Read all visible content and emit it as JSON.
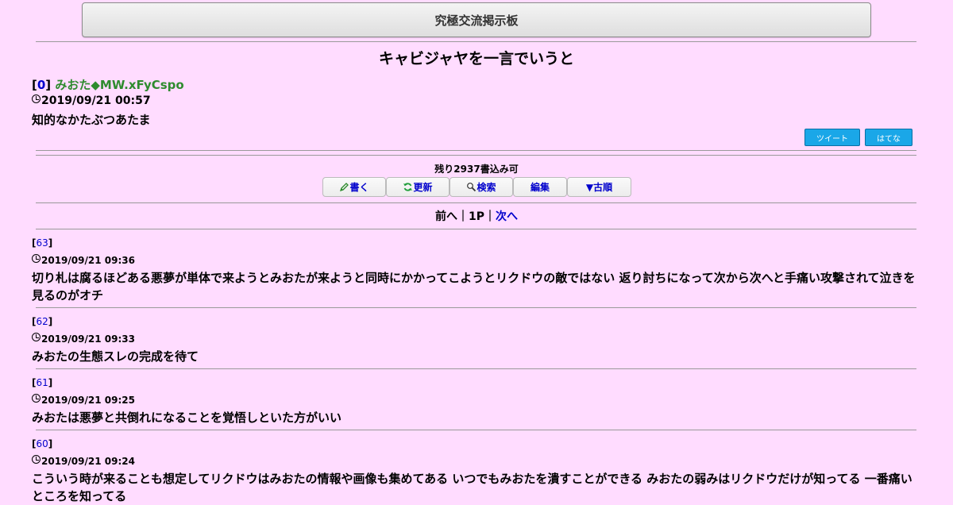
{
  "board": {
    "title": "究極交流掲示板"
  },
  "thread": {
    "title": "キャビジャヤを一言でいうと"
  },
  "op": {
    "number": "0",
    "name": "みおた◆MW.xFyCspo",
    "date": "2019/09/21 00:57",
    "body": "知的なかたぶつあたま"
  },
  "share": {
    "tweet_label": "ツイート",
    "hatena_label": "はてな"
  },
  "remaining": "残り2937書込み可",
  "toolbar": {
    "write_label": "書く",
    "refresh_label": "更新",
    "search_label": "検索",
    "edit_label": "編集",
    "order_label": "▼古順"
  },
  "pager": {
    "prev": "前へ",
    "sep": "｜",
    "current": "1P",
    "next": "次へ"
  },
  "posts": [
    {
      "number": "63",
      "date": "2019/09/21 09:36",
      "body": "切り札は腐るほどある悪夢が単体で来ようとみおたが来ようと同時にかかってこようとリクドウの敵ではない 返り討ちになって次から次へと手痛い攻撃されて泣きを見るのがオチ"
    },
    {
      "number": "62",
      "date": "2019/09/21 09:33",
      "body": "みおたの生態スレの完成を待て"
    },
    {
      "number": "61",
      "date": "2019/09/21 09:25",
      "body": "みおたは悪夢と共倒れになることを覚悟しといた方がいい"
    },
    {
      "number": "60",
      "date": "2019/09/21 09:24",
      "body": "こういう時が来ることも想定してリクドウはみおたの情報や画像も集めてある いつでもみおたを潰すことができる みおたの弱みはリクドウだけが知ってる 一番痛いところを知ってる"
    }
  ]
}
